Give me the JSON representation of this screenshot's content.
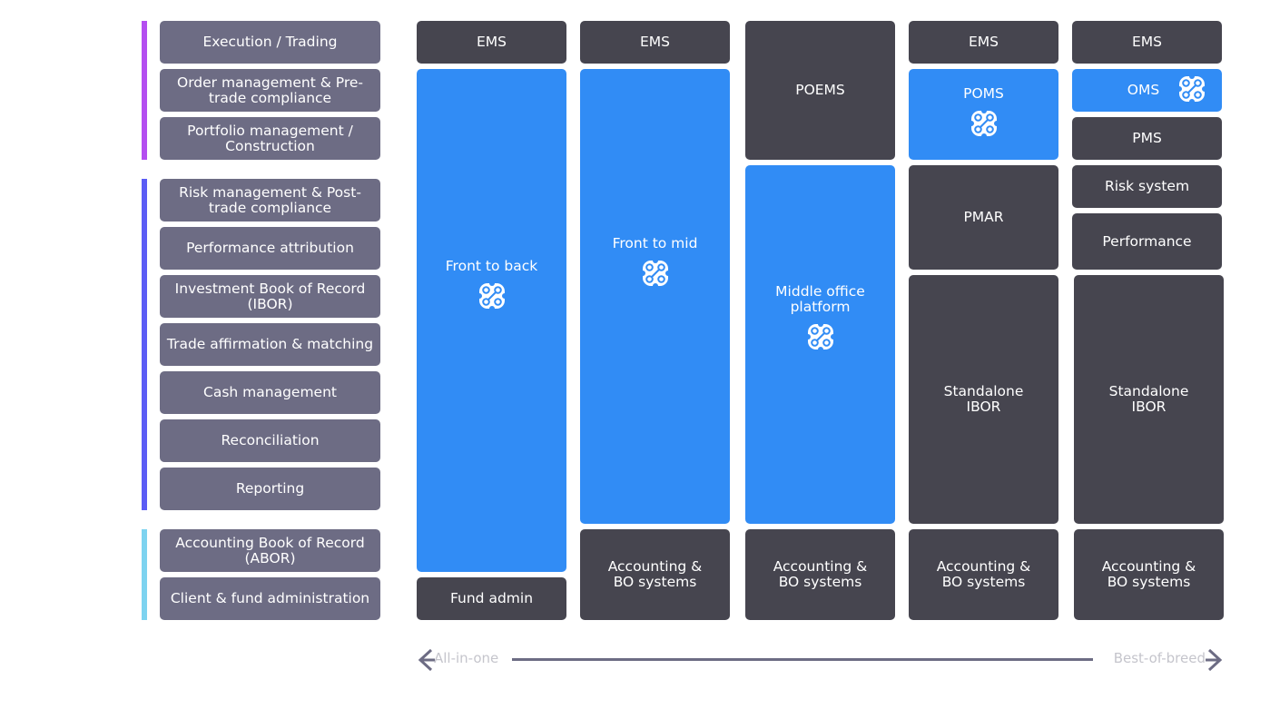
{
  "colors": {
    "front_office": "#b44ef0",
    "middle_office": "#5b5cf5",
    "back_office": "#7dd3f0",
    "function_box": "#6d6c84",
    "system_box": "#46454f",
    "platform_box": "#318cf5"
  },
  "functions": [
    "Execution / Trading",
    "Order management & Pre-trade compliance",
    "Portfolio management / Construction",
    "Risk management & Post-trade compliance",
    "Performance attribution",
    "Investment Book of Record (IBOR)",
    "Trade affirmation & matching",
    "Cash management",
    "Reconciliation",
    "Reporting",
    "Accounting Book of Record (ABOR)",
    "Client & fund administration"
  ],
  "columns": [
    {
      "blocks": [
        {
          "label": "EMS"
        },
        {
          "label": "Front to back",
          "icon": "platform-icon"
        },
        {
          "label": "Fund admin"
        }
      ]
    },
    {
      "blocks": [
        {
          "label": "EMS"
        },
        {
          "label": "Front to mid",
          "icon": "platform-icon"
        },
        {
          "label": "Accounting & BO systems"
        }
      ]
    },
    {
      "blocks": [
        {
          "label": "POEMS"
        },
        {
          "label": "Middle office platform",
          "icon": "platform-icon"
        },
        {
          "label": "Accounting & BO systems"
        }
      ]
    },
    {
      "blocks": [
        {
          "label": "EMS"
        },
        {
          "label": "POMS",
          "icon": "platform-icon"
        },
        {
          "label": "PMAR"
        },
        {
          "label": "Standalone IBOR"
        },
        {
          "label": "Accounting & BO systems"
        }
      ]
    },
    {
      "blocks": [
        {
          "label": "EMS"
        },
        {
          "label": "OMS",
          "icon": "platform-icon"
        },
        {
          "label": "PMS"
        },
        {
          "label": "Risk system"
        },
        {
          "label": "Performance"
        },
        {
          "label": "Standalone IBOR"
        },
        {
          "label": "Accounting & BO systems"
        }
      ]
    }
  ],
  "axis": {
    "left_label": "All-in-one",
    "right_label": "Best-of-breed"
  }
}
